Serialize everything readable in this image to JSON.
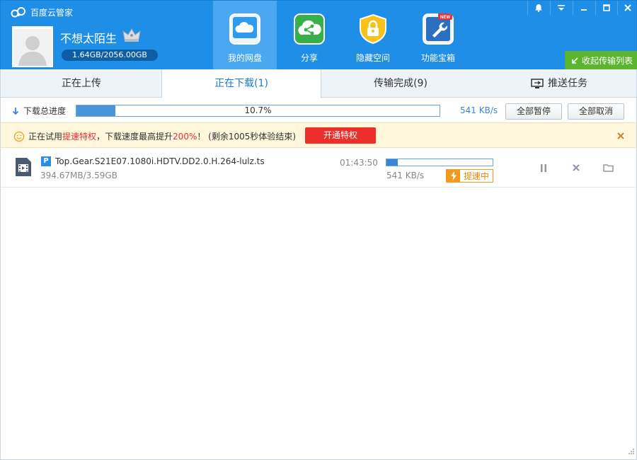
{
  "app": {
    "title": "百度云管家",
    "username": "不想太陌生",
    "quota": "1.64GB/2056.00GB"
  },
  "nav": [
    {
      "label": "我的网盘",
      "icon": "cloud-icon"
    },
    {
      "label": "分享",
      "icon": "share-icon"
    },
    {
      "label": "隐藏空间",
      "icon": "lock-icon"
    },
    {
      "label": "功能宝箱",
      "icon": "wrench-icon",
      "badge": "NEW"
    }
  ],
  "collapse_label": "收起传输列表",
  "tabs": {
    "upload": "正在上传",
    "download": "正在下载(1)",
    "done": "传输完成(9)",
    "push": "推送任务"
  },
  "progress": {
    "label": "下载总进度",
    "percent_text": "10.7%",
    "fraction": 0.107,
    "speed": "541 KB/s",
    "pause_all": "全部暂停",
    "cancel_all": "全部取消"
  },
  "notice": {
    "pre": "正在试用",
    "highlight1": "提速特权",
    "mid": "，下载速度最高提升",
    "highlight2": "200%",
    "post": "！ (剩余1005秒体验结束)",
    "button": "开通特权"
  },
  "task": {
    "badge": "P",
    "name": "Top.Gear.S21E07.1080i.HDTV.DD2.0.H.264-lulz.ts",
    "size": "394.67MB/3.59GB",
    "time_left": "01:43:50",
    "progress_fraction": 0.107,
    "speed": "541 KB/s",
    "boost_label": "提速中"
  },
  "colors": {
    "header": "#1e8ee6",
    "accent_green": "#5cb531",
    "alert_red": "#ec2f2b",
    "boost_orange": "#f39a1e"
  }
}
